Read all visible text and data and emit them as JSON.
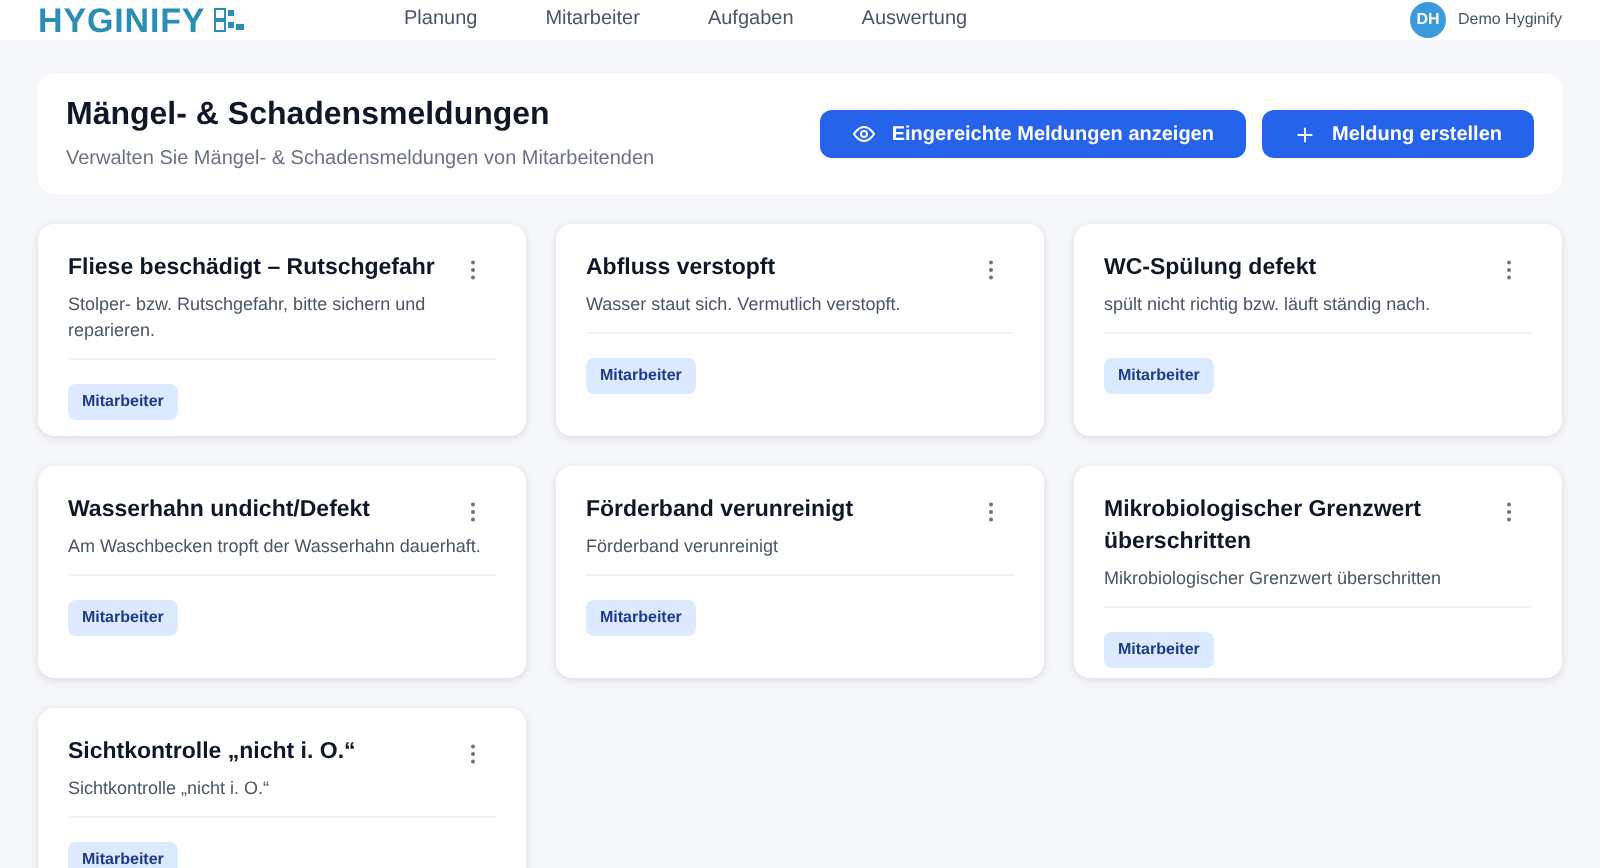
{
  "topbar": {
    "logo": "HYGINIFY",
    "nav": [
      {
        "label": "Planung",
        "selected": false
      },
      {
        "label": "Mitarbeiter",
        "selected": false
      },
      {
        "label": "Aufgaben",
        "selected": false
      },
      {
        "label": "Auswertung",
        "selected": false
      }
    ],
    "user": {
      "initials": "DH",
      "company": "Demo Hyginify"
    }
  },
  "header": {
    "title": "Mängel- & Schadensmeldungen",
    "subtitle": "Verwalten Sie Mängel- & Schadensmeldungen von Mitarbeitenden",
    "buttons": [
      {
        "label": "Eingereichte Meldungen anzeigen",
        "kind": "view"
      },
      {
        "label": "Meldung erstellen",
        "kind": "create"
      }
    ]
  },
  "reports": [
    {
      "title": "Fliese beschädigt – Rutschgefahr",
      "description": "Stolper- bzw. Rutschgefahr, bitte sichern und reparieren.",
      "tag": "Mitarbeiter"
    },
    {
      "title": "Abfluss verstopft",
      "description": "Wasser staut sich. Vermutlich verstopft.",
      "tag": "Mitarbeiter"
    },
    {
      "title": "WC-Spülung defekt",
      "description": "spült nicht richtig bzw. läuft ständig nach.",
      "tag": "Mitarbeiter"
    },
    {
      "title": "Wasserhahn undicht/Defekt",
      "description": "Am Waschbecken tropft der Wasserhahn dauerhaft.",
      "tag": "Mitarbeiter"
    },
    {
      "title": "Förderband verunreinigt",
      "description": "Förderband verunreinigt",
      "tag": "Mitarbeiter"
    },
    {
      "title": "Mikrobiologischer Grenzwert überschritten",
      "description": "Mikrobiologischer Grenzwert überschritten",
      "tag": "Mitarbeiter"
    },
    {
      "title": "Sichtkontrolle „nicht i. O.“",
      "description": "Sichtkontrolle „nicht i. O.“",
      "tag": "Mitarbeiter"
    }
  ]
}
